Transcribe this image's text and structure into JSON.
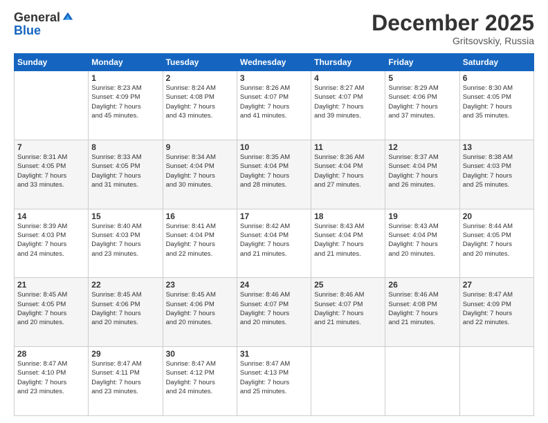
{
  "logo": {
    "general": "General",
    "blue": "Blue"
  },
  "header": {
    "month": "December 2025",
    "location": "Gritsovskiy, Russia"
  },
  "days_of_week": [
    "Sunday",
    "Monday",
    "Tuesday",
    "Wednesday",
    "Thursday",
    "Friday",
    "Saturday"
  ],
  "weeks": [
    [
      {
        "day": "",
        "info": ""
      },
      {
        "day": "1",
        "info": "Sunrise: 8:23 AM\nSunset: 4:09 PM\nDaylight: 7 hours\nand 45 minutes."
      },
      {
        "day": "2",
        "info": "Sunrise: 8:24 AM\nSunset: 4:08 PM\nDaylight: 7 hours\nand 43 minutes."
      },
      {
        "day": "3",
        "info": "Sunrise: 8:26 AM\nSunset: 4:07 PM\nDaylight: 7 hours\nand 41 minutes."
      },
      {
        "day": "4",
        "info": "Sunrise: 8:27 AM\nSunset: 4:07 PM\nDaylight: 7 hours\nand 39 minutes."
      },
      {
        "day": "5",
        "info": "Sunrise: 8:29 AM\nSunset: 4:06 PM\nDaylight: 7 hours\nand 37 minutes."
      },
      {
        "day": "6",
        "info": "Sunrise: 8:30 AM\nSunset: 4:05 PM\nDaylight: 7 hours\nand 35 minutes."
      }
    ],
    [
      {
        "day": "7",
        "info": "Sunrise: 8:31 AM\nSunset: 4:05 PM\nDaylight: 7 hours\nand 33 minutes."
      },
      {
        "day": "8",
        "info": "Sunrise: 8:33 AM\nSunset: 4:05 PM\nDaylight: 7 hours\nand 31 minutes."
      },
      {
        "day": "9",
        "info": "Sunrise: 8:34 AM\nSunset: 4:04 PM\nDaylight: 7 hours\nand 30 minutes."
      },
      {
        "day": "10",
        "info": "Sunrise: 8:35 AM\nSunset: 4:04 PM\nDaylight: 7 hours\nand 28 minutes."
      },
      {
        "day": "11",
        "info": "Sunrise: 8:36 AM\nSunset: 4:04 PM\nDaylight: 7 hours\nand 27 minutes."
      },
      {
        "day": "12",
        "info": "Sunrise: 8:37 AM\nSunset: 4:04 PM\nDaylight: 7 hours\nand 26 minutes."
      },
      {
        "day": "13",
        "info": "Sunrise: 8:38 AM\nSunset: 4:03 PM\nDaylight: 7 hours\nand 25 minutes."
      }
    ],
    [
      {
        "day": "14",
        "info": "Sunrise: 8:39 AM\nSunset: 4:03 PM\nDaylight: 7 hours\nand 24 minutes."
      },
      {
        "day": "15",
        "info": "Sunrise: 8:40 AM\nSunset: 4:03 PM\nDaylight: 7 hours\nand 23 minutes."
      },
      {
        "day": "16",
        "info": "Sunrise: 8:41 AM\nSunset: 4:04 PM\nDaylight: 7 hours\nand 22 minutes."
      },
      {
        "day": "17",
        "info": "Sunrise: 8:42 AM\nSunset: 4:04 PM\nDaylight: 7 hours\nand 21 minutes."
      },
      {
        "day": "18",
        "info": "Sunrise: 8:43 AM\nSunset: 4:04 PM\nDaylight: 7 hours\nand 21 minutes."
      },
      {
        "day": "19",
        "info": "Sunrise: 8:43 AM\nSunset: 4:04 PM\nDaylight: 7 hours\nand 20 minutes."
      },
      {
        "day": "20",
        "info": "Sunrise: 8:44 AM\nSunset: 4:05 PM\nDaylight: 7 hours\nand 20 minutes."
      }
    ],
    [
      {
        "day": "21",
        "info": "Sunrise: 8:45 AM\nSunset: 4:05 PM\nDaylight: 7 hours\nand 20 minutes."
      },
      {
        "day": "22",
        "info": "Sunrise: 8:45 AM\nSunset: 4:06 PM\nDaylight: 7 hours\nand 20 minutes."
      },
      {
        "day": "23",
        "info": "Sunrise: 8:45 AM\nSunset: 4:06 PM\nDaylight: 7 hours\nand 20 minutes."
      },
      {
        "day": "24",
        "info": "Sunrise: 8:46 AM\nSunset: 4:07 PM\nDaylight: 7 hours\nand 20 minutes."
      },
      {
        "day": "25",
        "info": "Sunrise: 8:46 AM\nSunset: 4:07 PM\nDaylight: 7 hours\nand 21 minutes."
      },
      {
        "day": "26",
        "info": "Sunrise: 8:46 AM\nSunset: 4:08 PM\nDaylight: 7 hours\nand 21 minutes."
      },
      {
        "day": "27",
        "info": "Sunrise: 8:47 AM\nSunset: 4:09 PM\nDaylight: 7 hours\nand 22 minutes."
      }
    ],
    [
      {
        "day": "28",
        "info": "Sunrise: 8:47 AM\nSunset: 4:10 PM\nDaylight: 7 hours\nand 23 minutes."
      },
      {
        "day": "29",
        "info": "Sunrise: 8:47 AM\nSunset: 4:11 PM\nDaylight: 7 hours\nand 23 minutes."
      },
      {
        "day": "30",
        "info": "Sunrise: 8:47 AM\nSunset: 4:12 PM\nDaylight: 7 hours\nand 24 minutes."
      },
      {
        "day": "31",
        "info": "Sunrise: 8:47 AM\nSunset: 4:13 PM\nDaylight: 7 hours\nand 25 minutes."
      },
      {
        "day": "",
        "info": ""
      },
      {
        "day": "",
        "info": ""
      },
      {
        "day": "",
        "info": ""
      }
    ]
  ]
}
